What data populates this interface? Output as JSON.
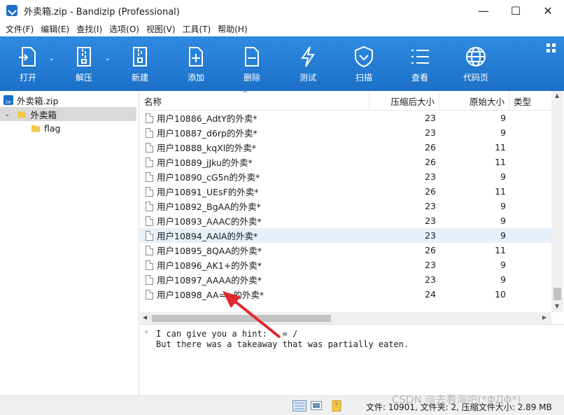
{
  "window": {
    "title": "外卖箱.zip - Bandizip (Professional)",
    "controls": [
      "—",
      "☐",
      "✕"
    ]
  },
  "menu": [
    "文件(F)",
    "编辑(E)",
    "查找(I)",
    "选项(O)",
    "视图(V)",
    "工具(T)",
    "帮助(H)"
  ],
  "toolbar": {
    "open": "打开",
    "extract": "解压",
    "new": "新建",
    "add": "添加",
    "delete": "删除",
    "test": "测试",
    "scan": "扫描",
    "view": "查看",
    "codepage": "代码页"
  },
  "tree": {
    "root": "外卖箱.zip",
    "folder": "外卖箱",
    "sub": "flag"
  },
  "columns": {
    "name": "名称",
    "compressed": "压缩后大小",
    "original": "原始大小",
    "type": "类型"
  },
  "files": [
    {
      "name": "用户10886_AdtY的外卖*",
      "compressed": "23",
      "original": "9"
    },
    {
      "name": "用户10887_d6rp的外卖*",
      "compressed": "23",
      "original": "9"
    },
    {
      "name": "用户10888_kqXl的外卖*",
      "compressed": "26",
      "original": "11"
    },
    {
      "name": "用户10889_jJku的外卖*",
      "compressed": "26",
      "original": "11"
    },
    {
      "name": "用户10890_cG5n的外卖*",
      "compressed": "23",
      "original": "9"
    },
    {
      "name": "用户10891_UEsF的外卖*",
      "compressed": "26",
      "original": "11"
    },
    {
      "name": "用户10892_BgAA的外卖*",
      "compressed": "23",
      "original": "9"
    },
    {
      "name": "用户10893_AAAC的外卖*",
      "compressed": "23",
      "original": "9"
    },
    {
      "name": "用户10894_AAlA的外卖*",
      "compressed": "23",
      "original": "9"
    },
    {
      "name": "用户10895_8QAA的外卖*",
      "compressed": "26",
      "original": "11"
    },
    {
      "name": "用户10896_AK1+的外卖*",
      "compressed": "23",
      "original": "9"
    },
    {
      "name": "用户10897_AAAA的外卖*",
      "compressed": "23",
      "original": "9"
    },
    {
      "name": "用户10898_AA==的外卖*",
      "compressed": "24",
      "original": "10"
    }
  ],
  "comment": {
    "line1": "I can give you a hint: - = /",
    "line2": "But there was a takeaway that was partially eaten."
  },
  "status": {
    "text": "文件: 10901, 文件夹: 2, 压缩文件大小: 2.89 MB"
  },
  "watermark": "CSDN @去看海吧(*ΦДΦ*)",
  "colors": {
    "toolbar": "#1c70c8",
    "selected_tree": "#d9d9d9",
    "hover_row": "#e6f0fb",
    "arrow": "#e0282e"
  }
}
